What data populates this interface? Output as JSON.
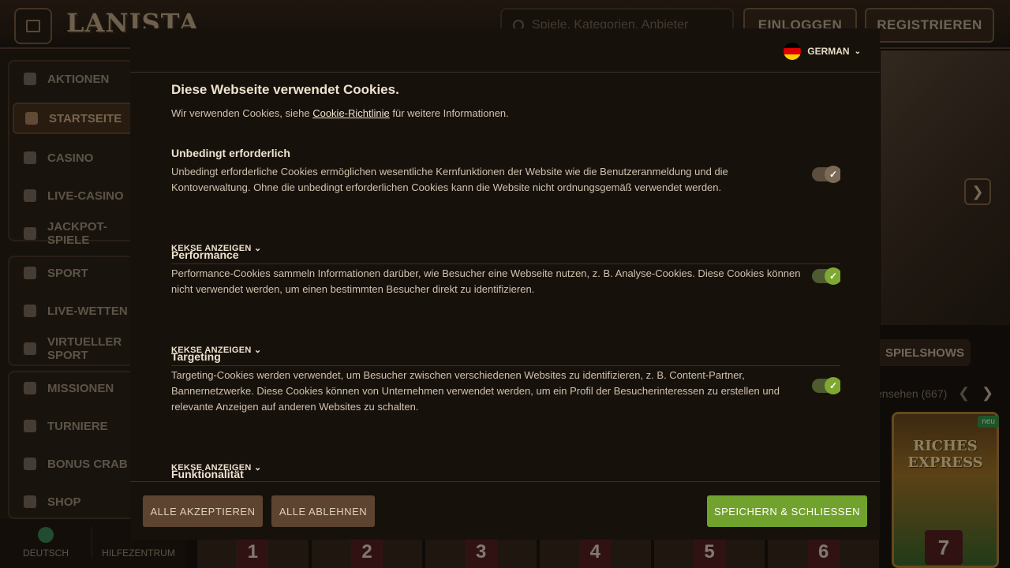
{
  "header": {
    "logo": "LANISTA",
    "search_placeholder": "Spiele, Kategorien, Anbieter",
    "login": "EINLOGGEN",
    "register": "REGISTRIEREN"
  },
  "sidebar": {
    "items": [
      {
        "label": "AKTIONEN",
        "icon": "gift-icon"
      },
      {
        "label": "STARTSEITE",
        "icon": "helmet-icon"
      },
      {
        "label": "CASINO",
        "icon": "casino-icon"
      },
      {
        "label": "LIVE-CASINO",
        "icon": "cards-icon"
      },
      {
        "label": "JACKPOT-SPIELE",
        "icon": "clover-icon"
      },
      {
        "label": "SPORT",
        "icon": "ball-icon"
      },
      {
        "label": "LIVE-WETTEN",
        "icon": "live-icon"
      },
      {
        "label": "VIRTUELLER SPORT",
        "icon": "virtual-icon"
      },
      {
        "label": "MISSIONEN",
        "icon": "target-icon"
      },
      {
        "label": "TURNIERE",
        "icon": "podium-icon"
      },
      {
        "label": "BONUS CRAB",
        "icon": "claw-icon"
      },
      {
        "label": "SHOP",
        "icon": "bag-icon"
      }
    ],
    "language": "DEUTSCH",
    "help": "HILFEZENTRUM"
  },
  "background": {
    "shows_tab": "SPIELSHOWS",
    "seen_count": "ensehen (667)",
    "game_title": "RICHES EXPRESS",
    "game_badge": "neu",
    "numbers": [
      "1",
      "2",
      "3",
      "4",
      "5",
      "6",
      "7"
    ]
  },
  "cookie_modal": {
    "language": "GERMAN",
    "title": "Diese Webseite verwendet Cookies.",
    "intro_before": "Wir verwenden Cookies, siehe ",
    "intro_link": "Cookie-Richtlinie",
    "intro_after": " für weitere Informationen.",
    "show_cookies": "KEKSE ANZEIGEN",
    "sections": [
      {
        "title": "Unbedingt erforderlich",
        "description": "Unbedingt erforderliche Cookies ermöglichen wesentliche Kernfunktionen der Website wie die Benutzeranmeldung und die Kontoverwaltung. Ohne die unbedingt erforderlichen Cookies kann die Website nicht ordnungsgemäß verwendet werden.",
        "enabled": true,
        "locked": true
      },
      {
        "title": "Performance",
        "description": "Performance-Cookies sammeln Informationen darüber, wie Besucher eine Webseite nutzen, z. B. Analyse-Cookies. Diese Cookies können nicht verwendet werden, um einen bestimmten Besucher direkt zu identifizieren.",
        "enabled": true,
        "locked": false
      },
      {
        "title": "Targeting",
        "description": "Targeting-Cookies werden verwendet, um Besucher zwischen verschiedenen Websites zu identifizieren, z. B. Content-Partner, Bannernetzwerke. Diese Cookies können von Unternehmen verwendet werden, um ein Profil der Besucherinteressen zu erstellen und relevante Anzeigen auf anderen Websites zu schalten.",
        "enabled": true,
        "locked": false
      },
      {
        "title": "Funktionalität",
        "description": "",
        "enabled": true,
        "locked": false
      }
    ],
    "buttons": {
      "accept_all": "ALLE AKZEPTIEREN",
      "reject_all": "ALLE ABLEHNEN",
      "save_close": "SPEICHERN & SCHLIESSEN"
    }
  },
  "colors": {
    "modal_bg": "#17110c",
    "accent_green": "#72a22e",
    "button_brown": "#5c4431"
  }
}
